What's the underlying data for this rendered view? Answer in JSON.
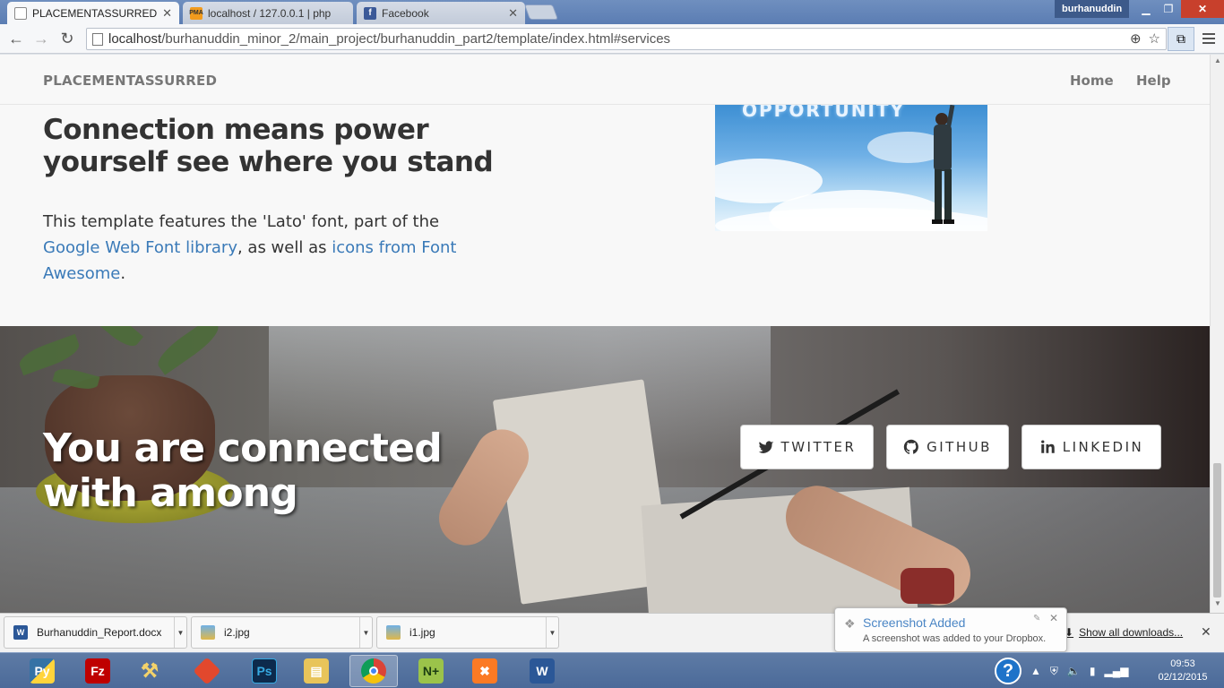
{
  "browser": {
    "tabs": [
      {
        "label": "PLACEMENTASSURRED",
        "icon": "page-icon",
        "active": true
      },
      {
        "label": "localhost / 127.0.0.1 | php",
        "icon": "phpmyadmin-icon",
        "active": false
      },
      {
        "label": "Facebook",
        "icon": "facebook-icon",
        "active": false
      }
    ],
    "user_name": "burhanuddin",
    "url_host": "localhost",
    "url_path": "/burhanuddin_minor_2/main_project/burhanuddin_part2/template/index.html#services"
  },
  "site": {
    "brand": "PLACEMENTASSURRED",
    "nav": {
      "home": "Home",
      "help": "Help"
    },
    "section": {
      "heading": "Connection means power yourself see where you stand",
      "text_before": "This template features the 'Lato' font, part of the ",
      "link1": "Google Web Font library",
      "text_middle": ", as well as ",
      "link2": "icons from Font Awesome",
      "text_after": ".",
      "image_caption": "OPPORTUNITY"
    },
    "banner": {
      "heading": "You are connected with among",
      "buttons": {
        "twitter": "TWITTER",
        "github": "GITHUB",
        "linkedin": "LINKEDIN"
      }
    }
  },
  "downloads": {
    "items": [
      {
        "name": "Burhanuddin_Report.docx",
        "icon": "word-doc-icon"
      },
      {
        "name": "i2.jpg",
        "icon": "image-file-icon"
      },
      {
        "name": "i1.jpg",
        "icon": "image-file-icon"
      }
    ],
    "show_all": "Show all downloads..."
  },
  "toast": {
    "title": "Screenshot Added",
    "message": "A screenshot was added to your Dropbox."
  },
  "taskbar": {
    "apps": [
      "python-icon",
      "filezilla-icon",
      "tools-icon",
      "git-icon",
      "photoshop-icon",
      "file-explorer-icon",
      "chrome-icon",
      "notepad-plus-plus-icon",
      "xampp-icon",
      "word-icon"
    ],
    "time": "09:53",
    "date": "02/12/2015"
  },
  "colors": {
    "link": "#3a7ab8",
    "win_close": "#c8402c",
    "toast_title": "#4b86c5"
  }
}
